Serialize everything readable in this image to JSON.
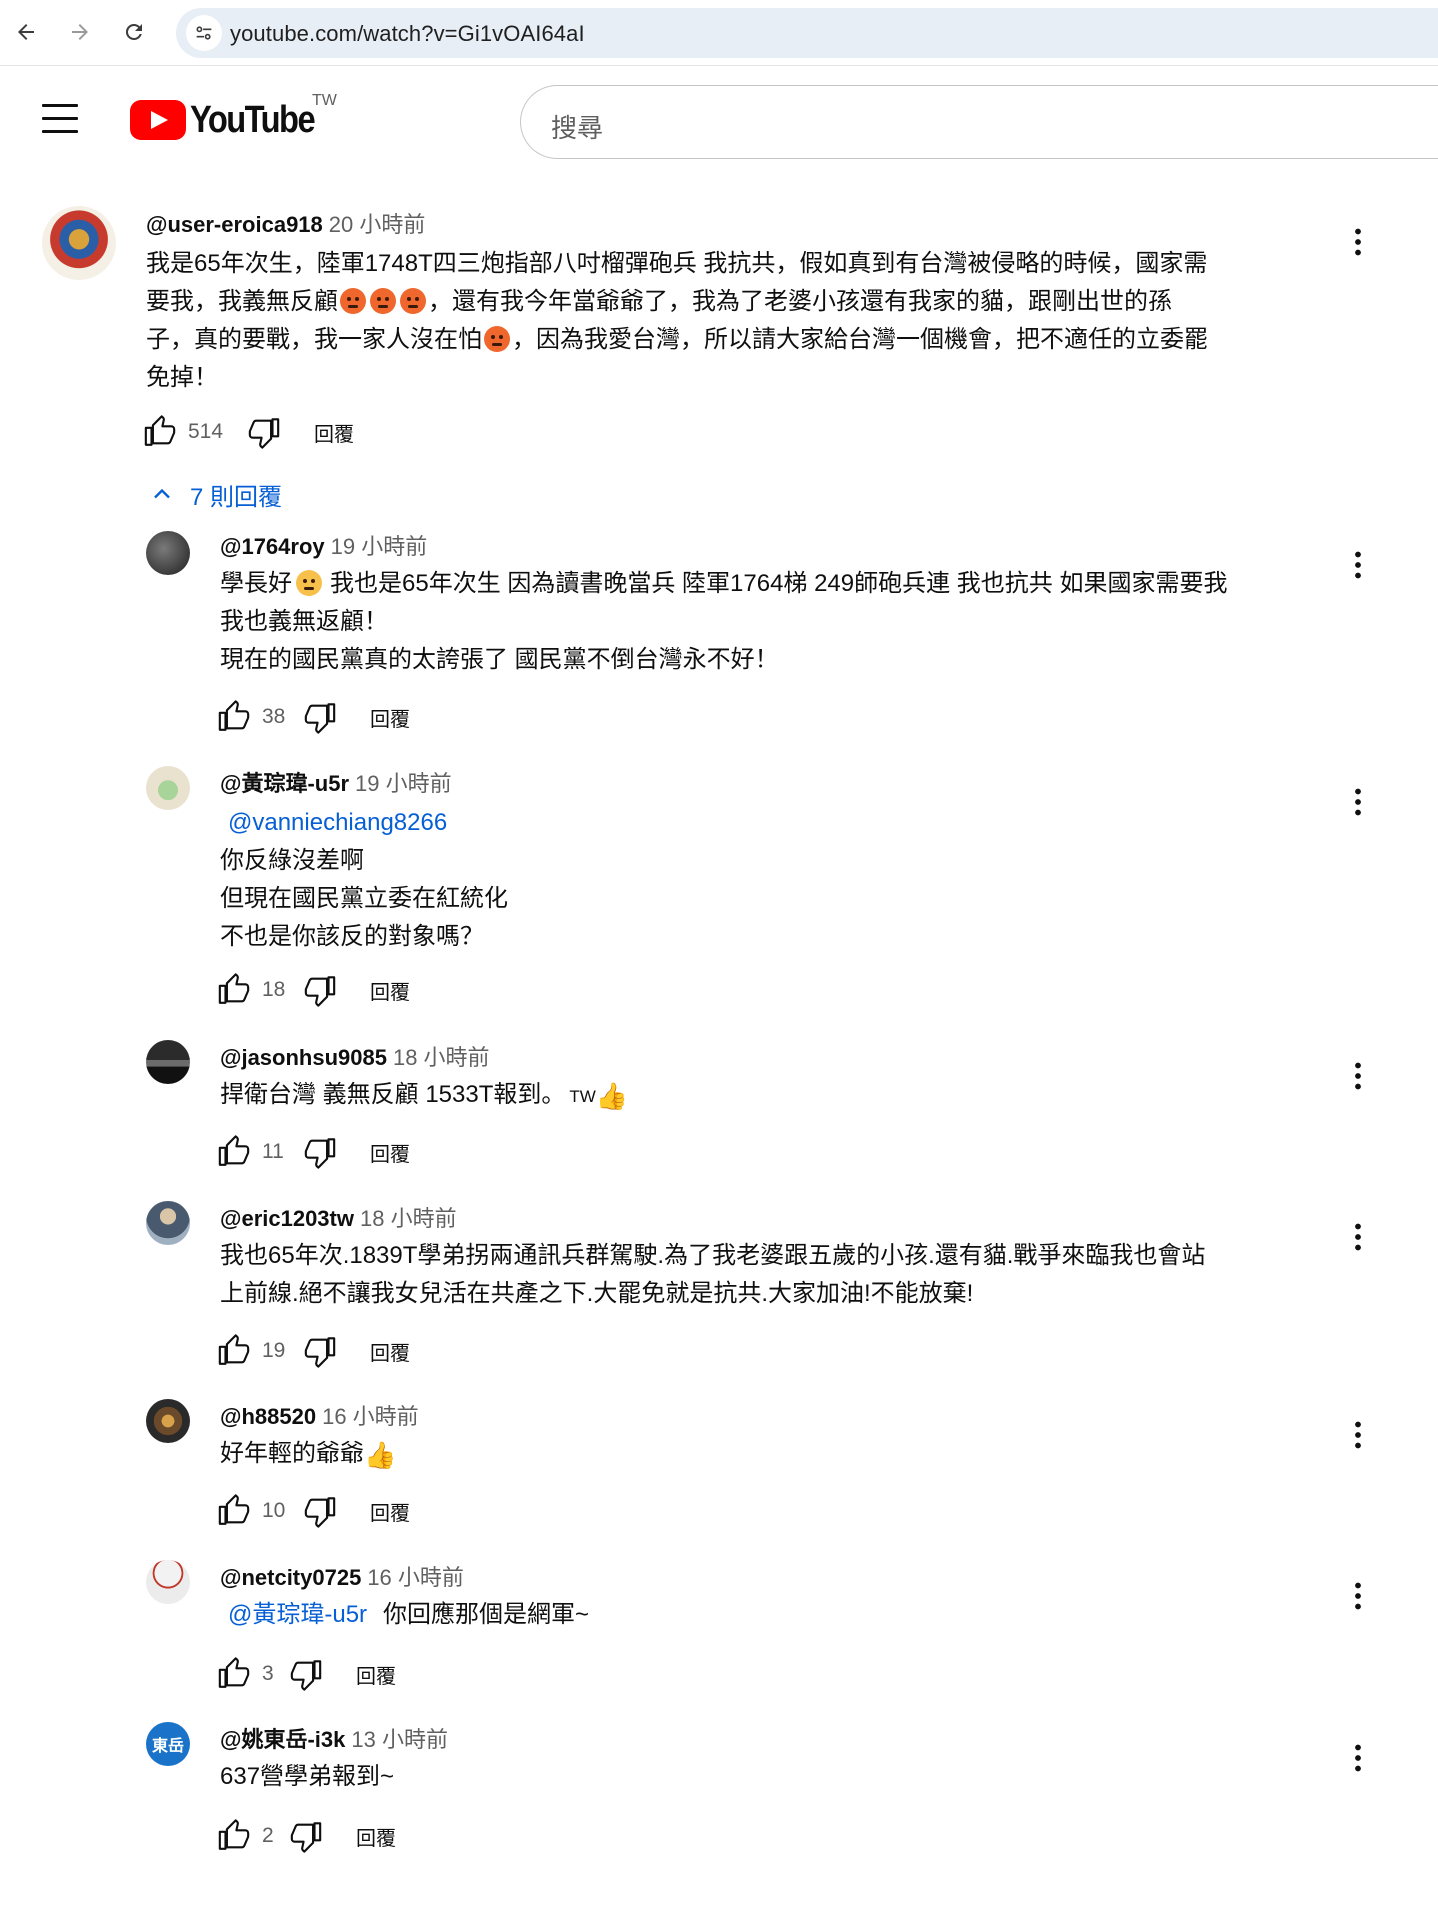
{
  "browser": {
    "url": "youtube.com/watch?v=Gi1vOAI64aI"
  },
  "header": {
    "logo_text": "YouTube",
    "region": "TW",
    "search_placeholder": "搜尋"
  },
  "comment": {
    "author": "@user-eroica918",
    "time": "20 小時前",
    "text_lines": [
      "我是65年次生，陸軍1748T四三炮指部八吋榴彈砲兵 我抗共，假如真到有台灣被侵略的時候，國家需",
      "要我，我義無反顧",
      "，還有我今年當爺爺了，我為了老婆小孩還有我家的貓，跟剛出世的孫",
      "子，真的要戰，我一家人沒在怕",
      "，因為我愛台灣，所以請大家給台灣一個機會，把不適任的立委罷",
      "免掉！"
    ],
    "likes": "514",
    "reply_label": "回覆"
  },
  "replies_toggle": {
    "label": "7 則回覆"
  },
  "replies": [
    {
      "author": "@1764roy",
      "time": "19 小時前",
      "lines": [
        "學長好",
        "我也是65年次生 因為讀書晚當兵 陸軍1764梯 249師砲兵連 我也抗共 如果國家需要我",
        "我也義無返顧！",
        "現在的國民黨真的太誇張了 國民黨不倒台灣永不好！"
      ],
      "likes": "38",
      "reply_label": "回覆"
    },
    {
      "author": "@黃琮瑋-u5r",
      "time": "19 小時前",
      "mention": "@vanniechiang8266",
      "lines": [
        "你反綠沒差啊",
        "但現在國民黨立委在紅統化",
        "不也是你該反的對象嗎？"
      ],
      "likes": "18",
      "reply_label": "回覆"
    },
    {
      "author": "@jasonhsu9085",
      "time": "18 小時前",
      "lines": [
        "捍衛台灣 義無反顧 1533T報到。",
        "TW"
      ],
      "likes": "11",
      "reply_label": "回覆"
    },
    {
      "author": "@eric1203tw",
      "time": "18 小時前",
      "lines": [
        "我也65年次.1839T學弟拐兩通訊兵群駕駛.為了我老婆跟五歲的小孩.還有貓.戰爭來臨我也會站",
        "上前線.絕不讓我女兒活在共產之下.大罷免就是抗共.大家加油!不能放棄!"
      ],
      "likes": "19",
      "reply_label": "回覆"
    },
    {
      "author": "@h88520",
      "time": "16 小時前",
      "lines": [
        "好年輕的爺爺"
      ],
      "likes": "10",
      "reply_label": "回覆"
    },
    {
      "author": "@netcity0725",
      "time": "16 小時前",
      "mention": "@黃琮瑋-u5r",
      "lines": [
        "你回應那個是網軍~"
      ],
      "likes": "3",
      "reply_label": "回覆"
    },
    {
      "author": "@姚東岳-i3k",
      "time": "13 小時前",
      "avatar_text": "東岳",
      "lines": [
        "637營學弟報到~"
      ],
      "likes": "2",
      "reply_label": "回覆"
    }
  ],
  "icons": {
    "back": "arrow-left-icon",
    "forward": "arrow-right-icon",
    "reload": "reload-icon",
    "site_info": "tune-icon",
    "menu": "hamburger-icon",
    "like": "thumb-up-icon",
    "dislike": "thumb-down-icon",
    "more": "more-vert-icon",
    "collapse": "chevron-up-icon",
    "angry_emoji": "angry-face-emoji",
    "smile_emoji": "smiling-face-emoji",
    "thumbs_up_emoji": "thumbs-up-emoji"
  },
  "colors": {
    "brand": "#ff0000",
    "link": "#065fd4",
    "text": "#0f0f0f",
    "secondary_text": "#606060",
    "omnibox": "#e8eef6"
  }
}
